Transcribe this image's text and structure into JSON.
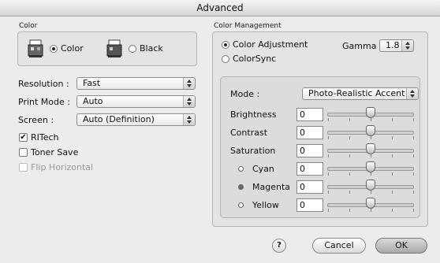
{
  "window": {
    "title": "Advanced"
  },
  "color_group": {
    "title": "Color",
    "options": [
      {
        "label": "Color",
        "selected": true
      },
      {
        "label": "Black",
        "selected": false
      }
    ]
  },
  "settings": {
    "resolution": {
      "label": "Resolution :",
      "value": "Fast"
    },
    "print_mode": {
      "label": "Print Mode :",
      "value": "Auto"
    },
    "screen": {
      "label": "Screen :",
      "value": "Auto (Definition)"
    }
  },
  "checkboxes": {
    "ritech": {
      "label": "RITech",
      "checked": true
    },
    "toner_save": {
      "label": "Toner Save",
      "checked": false
    },
    "flip_horizontal": {
      "label": "Flip Horizontal",
      "checked": false,
      "disabled": true
    }
  },
  "color_management": {
    "title": "Color Management",
    "color_adjustment": {
      "label": "Color Adjustment",
      "selected": true
    },
    "colorsync": {
      "label": "ColorSync",
      "selected": false
    },
    "gamma": {
      "label": "Gamma",
      "value": "1.8"
    }
  },
  "adjustment": {
    "mode_label": "Mode :",
    "mode_value": "Photo-Realistic Accent",
    "rows": [
      {
        "label": "Brightness",
        "value": "0",
        "position": 0.5
      },
      {
        "label": "Contrast",
        "value": "0",
        "position": 0.5
      },
      {
        "label": "Saturation",
        "value": "0",
        "position": 0.5
      },
      {
        "label": "Cyan",
        "value": "0",
        "position": 0.5,
        "dot": "empty"
      },
      {
        "label": "Magenta",
        "value": "0",
        "position": 0.5,
        "dot": "filled"
      },
      {
        "label": "Yellow",
        "value": "0",
        "position": 0.5,
        "dot": "empty"
      }
    ]
  },
  "footer": {
    "help_label": "?",
    "cancel_label": "Cancel",
    "ok_label": "OK"
  },
  "icons": [
    "color-printer-icon",
    "black-printer-icon",
    "help-icon",
    "popup-arrows-icon",
    "checkmark-icon"
  ]
}
